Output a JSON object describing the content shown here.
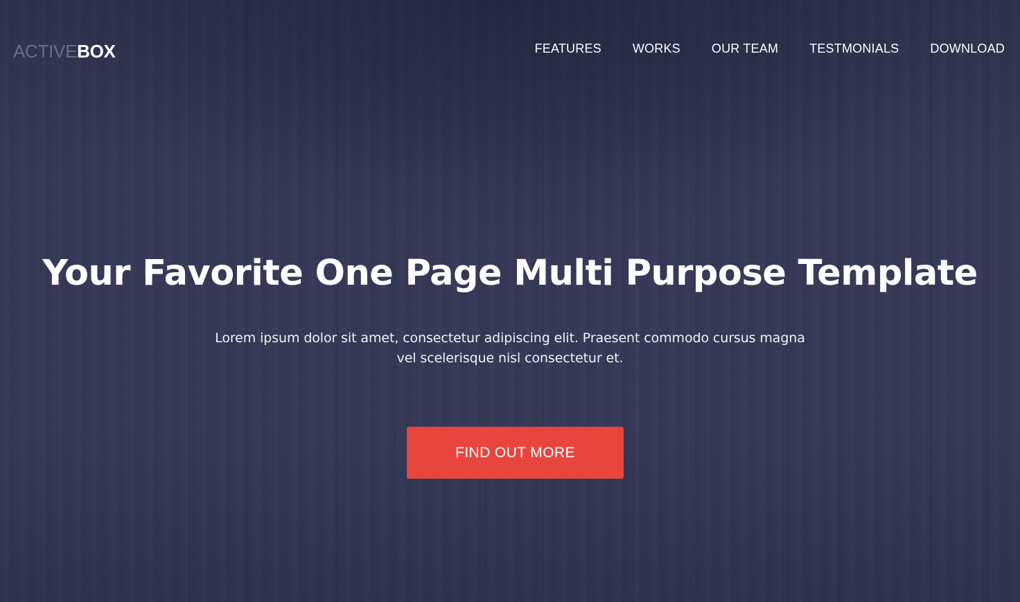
{
  "brand": {
    "light": "ACTIVE",
    "bold": "BOX"
  },
  "nav": {
    "items": [
      {
        "label": "FEATURES"
      },
      {
        "label": "WORKS"
      },
      {
        "label": "OUR TEAM"
      },
      {
        "label": "TESTMONIALS"
      },
      {
        "label": "DOWNLOAD"
      }
    ]
  },
  "hero": {
    "title": "Your Favorite One Page Multi Purpose Template",
    "description_line1": "Lorem ipsum dolor sit amet, consectetur adipiscing elit. Praesent commodo cursus magna",
    "description_line2": "vel scelerisque nisl consectetur et.",
    "cta_label": "FIND OUT MORE"
  },
  "colors": {
    "background": "#363a58",
    "accent": "#e8453f",
    "logo_light": "#6a6e86",
    "text": "#ffffff"
  }
}
